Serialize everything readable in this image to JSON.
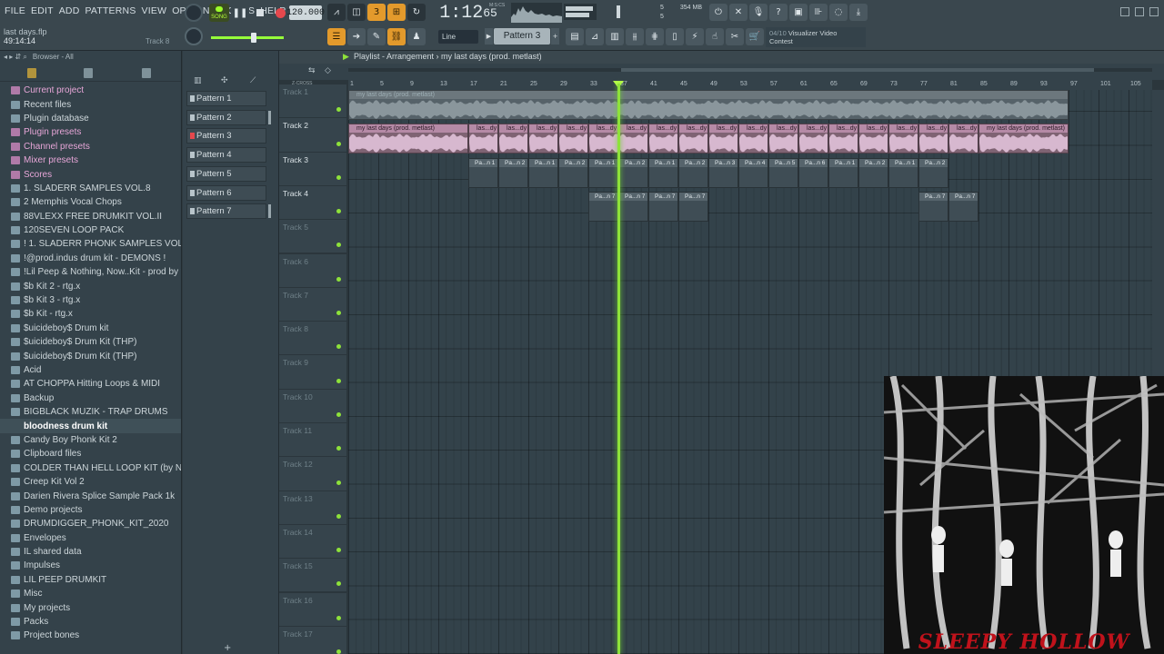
{
  "menu": [
    "FILE",
    "EDIT",
    "ADD",
    "PATTERNS",
    "VIEW",
    "OPTIONS",
    "TOOLS",
    "HELP"
  ],
  "project": {
    "file": "last days.flp",
    "elapsed": "49:14:14",
    "hint_track": "Track 8"
  },
  "transport": {
    "song_label": "SONG",
    "tempo": "120.000",
    "time_main": "1:12",
    "time_sub": "65",
    "time_unit": "M:S:CS"
  },
  "cpu": {
    "voices": "5",
    "cores": "5",
    "memory": "354 MB"
  },
  "snap": "Line",
  "current_pattern": "Pattern 3",
  "hint_panel": {
    "count": "04/10",
    "title": "Visualizer Video",
    "subtitle": "Contest"
  },
  "browser": {
    "header": "Browser - All",
    "items": [
      {
        "label": "Current project",
        "kind": "special"
      },
      {
        "label": "Recent files",
        "kind": "folder"
      },
      {
        "label": "Plugin database",
        "kind": "folder"
      },
      {
        "label": "Plugin presets",
        "kind": "special"
      },
      {
        "label": "Channel presets",
        "kind": "special"
      },
      {
        "label": "Mixer presets",
        "kind": "special"
      },
      {
        "label": "Scores",
        "kind": "special"
      },
      {
        "label": "1. SLADERR SAMPLES VOL.8",
        "kind": "folder"
      },
      {
        "label": "2 Memphis Vocal Chops",
        "kind": "folder"
      },
      {
        "label": "88VLEXX FREE DRUMKIT VOL.II",
        "kind": "folder"
      },
      {
        "label": "120SEVEN LOOP PACK",
        "kind": "folder"
      },
      {
        "label": "! 1. SLADERR PHONK SAMPLES VOL.2",
        "kind": "folder"
      },
      {
        "label": "!@prod.indus drum kit - DEMONS !",
        "kind": "folder"
      },
      {
        "label": "!Lil Peep & Nothing, Now..Kit - prod by yhello!",
        "kind": "folder"
      },
      {
        "label": "$b Kit 2 - rtg.x",
        "kind": "folder"
      },
      {
        "label": "$b Kit 3 - rtg.x",
        "kind": "folder"
      },
      {
        "label": "$b Kit - rtg.x",
        "kind": "folder"
      },
      {
        "label": "$uicideboy$ Drum kit",
        "kind": "folder"
      },
      {
        "label": "$uicideboy$ Drum Kit (THP)",
        "kind": "folder"
      },
      {
        "label": "$uicideboy$ Drum Kit (THP)",
        "kind": "folder"
      },
      {
        "label": "Acid",
        "kind": "folder"
      },
      {
        "label": "AT CHOPPA Hitting Loops & MIDI",
        "kind": "folder"
      },
      {
        "label": "Backup",
        "kind": "folder"
      },
      {
        "label": "BIGBLACK MUZIK - TRAP DRUMS",
        "kind": "folder"
      },
      {
        "label": "bloodness drum kit",
        "kind": "selected"
      },
      {
        "label": "Candy Boy Phonk Kit 2",
        "kind": "folder"
      },
      {
        "label": "Clipboard files",
        "kind": "folder"
      },
      {
        "label": "COLDER THAN HELL LOOP KIT (by NOVO)",
        "kind": "folder"
      },
      {
        "label": "Creep Kit Vol 2",
        "kind": "folder"
      },
      {
        "label": "Darien Rivera Splice Sample Pack 1k",
        "kind": "folder"
      },
      {
        "label": "Demo projects",
        "kind": "folder"
      },
      {
        "label": "DRUMDIGGER_PHONK_KIT_2020",
        "kind": "folder"
      },
      {
        "label": "Envelopes",
        "kind": "folder"
      },
      {
        "label": "IL shared data",
        "kind": "folder"
      },
      {
        "label": "Impulses",
        "kind": "folder"
      },
      {
        "label": "LIL PEEP DRUMKIT",
        "kind": "folder"
      },
      {
        "label": "Misc",
        "kind": "folder"
      },
      {
        "label": "My projects",
        "kind": "folder"
      },
      {
        "label": "Packs",
        "kind": "folder"
      },
      {
        "label": "Project bones",
        "kind": "folder"
      }
    ]
  },
  "patterns": [
    "Pattern 1",
    "Pattern 2",
    "Pattern 3",
    "Pattern 4",
    "Pattern 5",
    "Pattern 6",
    "Pattern 7"
  ],
  "playlist": {
    "title": "Playlist - Arrangement",
    "arrangement": "my last days (prod. metlast)",
    "ruler_header": "Z-CROSS",
    "ruler_marks": [
      "1",
      "5",
      "9",
      "13",
      "17",
      "21",
      "25",
      "29",
      "33",
      "37",
      "41",
      "45",
      "49",
      "53",
      "57",
      "61",
      "65",
      "69",
      "73",
      "77",
      "81",
      "85",
      "89",
      "93",
      "97",
      "101",
      "105"
    ],
    "tracks": [
      "Track 1",
      "Track 2",
      "Track 3",
      "Track 4",
      "Track 5",
      "Track 6",
      "Track 7",
      "Track 8",
      "Track 9",
      "Track 10",
      "Track 11",
      "Track 12",
      "Track 13",
      "Track 14",
      "Track 15",
      "Track 16",
      "Track 17"
    ],
    "audio_label": "my last days (prod. metlast)",
    "audio_chop_label": "las...dy",
    "track3_labels": [
      "Pa...n 1",
      "Pa...n 2",
      "Pa...n 1",
      "Pa...n 2",
      "Pa...n 1",
      "Pa...n 2",
      "Pa...n 1",
      "Pa...n 2",
      "Pa...n 3",
      "Pa...n 4",
      "Pa...n 5",
      "Pa...n 6",
      "Pa...n 1",
      "Pa...n 2",
      "Pa...n 1",
      "Pa...n 2"
    ],
    "track4_labels": [
      "Pa...n 7",
      "Pa...n 7",
      "Pa...n 7",
      "Pa...n 7",
      "Pa...n 7",
      "Pa...n 7"
    ]
  },
  "artwork": {
    "title": "SLEEPY HOLLOW"
  }
}
